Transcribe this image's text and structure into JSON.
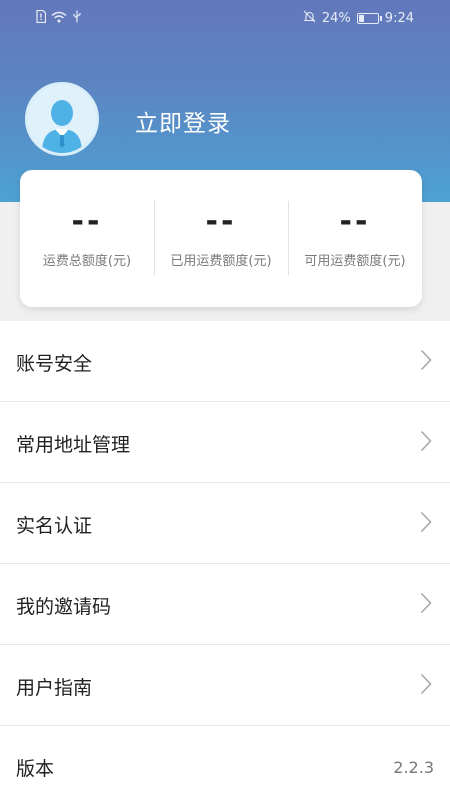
{
  "status_bar": {
    "left_icons": [
      "sim-card-icon",
      "wifi-icon",
      "usb-icon"
    ],
    "right_icons": [
      "notifications-off-icon",
      "battery-icon"
    ],
    "battery_percent": "24%",
    "time": "9:24"
  },
  "profile": {
    "avatar_icon": "user-avatar-icon",
    "login_label": "立即登录"
  },
  "stats": [
    {
      "value": "--",
      "label": "运费总额度(元)"
    },
    {
      "value": "--",
      "label": "已用运费额度(元)"
    },
    {
      "value": "--",
      "label": "可用运费额度(元)"
    }
  ],
  "menu": [
    {
      "label": "账号安全",
      "icon": "chevron-right-icon"
    },
    {
      "label": "常用地址管理",
      "icon": "chevron-right-icon"
    },
    {
      "label": "实名认证",
      "icon": "chevron-right-icon"
    },
    {
      "label": "我的邀请码",
      "icon": "chevron-right-icon"
    },
    {
      "label": "用户指南",
      "icon": "chevron-right-icon"
    }
  ],
  "version": {
    "label": "版本",
    "value": "2.2.3"
  },
  "colors": {
    "header_gradient_top": "#6377bb",
    "header_gradient_bottom": "#4da2d4",
    "background": "#f0f0f0",
    "card": "#ffffff"
  }
}
